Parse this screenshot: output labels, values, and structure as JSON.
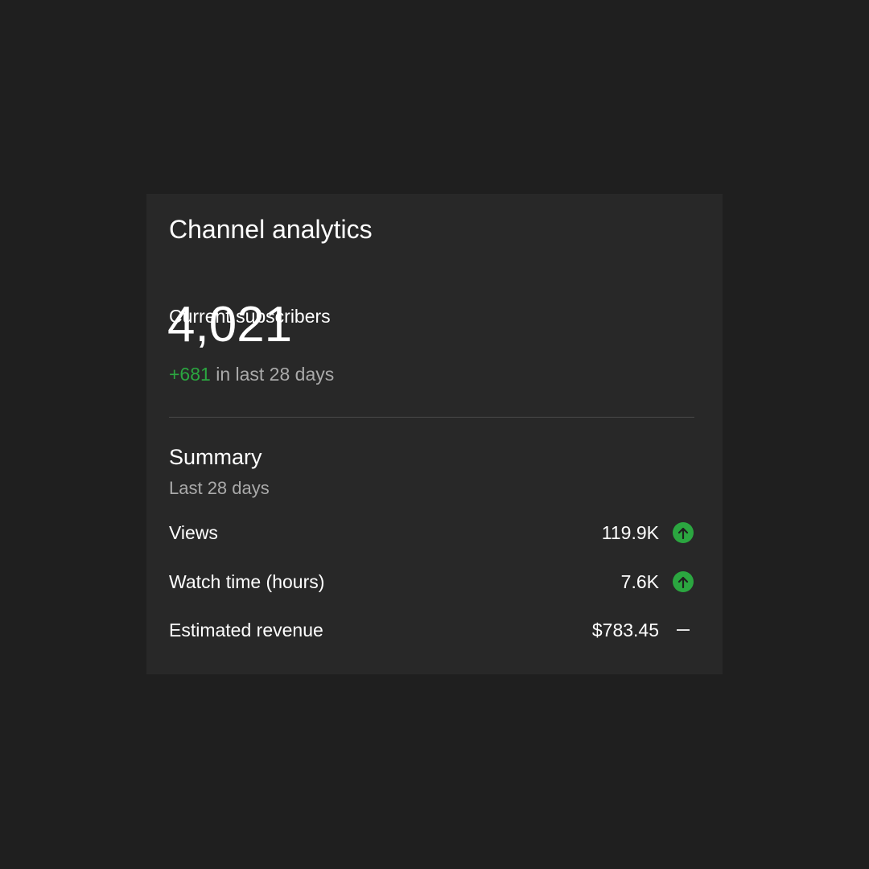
{
  "card": {
    "title": "Channel analytics"
  },
  "subscribers": {
    "label": "Current subscribers",
    "count": "4,021",
    "delta": "+681",
    "delta_suffix": " in last 28 days"
  },
  "summary": {
    "title": "Summary",
    "period": "Last 28 days",
    "metrics": [
      {
        "label": "Views",
        "value": "119.9K",
        "trend": "up",
        "trend_icon": "arrow-up-circle-icon"
      },
      {
        "label": "Watch time (hours)",
        "value": "7.6K",
        "trend": "up",
        "trend_icon": "arrow-up-circle-icon"
      },
      {
        "label": "Estimated revenue",
        "value": "$783.45",
        "trend": "flat",
        "trend_icon": "dash-icon"
      }
    ]
  },
  "colors": {
    "background": "#1f1f1f",
    "card": "#282828",
    "positive": "#2ba640",
    "muted_text": "#aaaaaa"
  }
}
